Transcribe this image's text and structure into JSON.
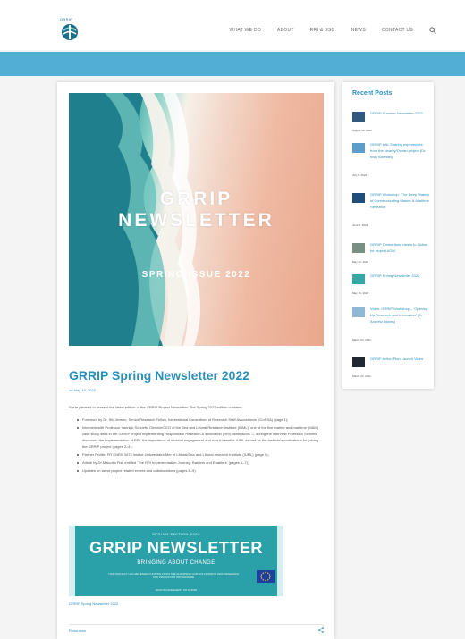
{
  "header": {
    "logo_text": "GRRIP",
    "nav": [
      "WHAT WE DO",
      "ABOUT",
      "RRI & SSG",
      "NEWS",
      "CONTACT US"
    ],
    "search_icon": "search-icon"
  },
  "hero": {
    "title_line1": "GRRIP",
    "title_line2": "NEWSLETTER",
    "subtitle": "SPRING ISSUE 2022"
  },
  "post": {
    "title": "GRRIP Spring Newsletter 2022",
    "date": "on May 19, 2022",
    "intro": "We're pleased to present the latest edition of the GRRIP Project Newsletter. The Spring 2022 edition contains:",
    "items": [
      "Foreword by Dr. Siri Jensen, Senior Research Fellow, International Consortium of Research Staff Associations (ICoRSA) (page 1);",
      "Interview with Professor Yannick Schoefs, Director/CEO of the Sea and Littoral Research Institute (IUML), one of the five marine and maritime (M&M) case study sites in the GRRIP project implementing Responsible Research & Innovation (RRI) dimensions — during the interview Professor Schoefs discusses the implementation of RRI, the importance of societal engagement and how it benefits IUML as well as the Institute's motivations for joining the GRRIP project (pages 2–4);",
      "Partner Profile: FR CNRS 3473 Institut Universitaire Mer et Littoral/Sea and Littoral research Institute (IUML) (page 5);",
      "Article by Dr Malcolm Fisk entitled 'The RRI Implementation Journey: Barriers and Enablers' (pages 6–7);",
      "Updates on latest project related events and collaborations (pages 8–9)."
    ],
    "newsletter_image": {
      "edition": "SPRING EDITION 2022",
      "title": "GRRIP NEWSLETTER",
      "subtitle": "BRINGING ABOUT CHANGE",
      "small_text": "THIS PROJECT HAS RECEIVED FUNDING FROM THE EUROPEAN UNION'S HORIZON 2020 RESEARCH AND INNOVATION PROGRAMME",
      "footer": "GRANT AGREEMENT NO 824595"
    },
    "caption": "GRRIP Spring Newsletter 2022",
    "footer_link": "Resources",
    "share_icon": "share-icon"
  },
  "sidebar": {
    "title": "Recent Posts",
    "posts": [
      {
        "title": "GRRIP Summer Newsletter 2022",
        "date": "August 30, 2022",
        "thumb_color": "#2f5a7d"
      },
      {
        "title": "GRRIP talk: Sharing experiences from the Nearby/Ocean project (Dr. Irish Scientist)",
        "date": "July 5, 2022",
        "thumb_color": "#5c9dc9"
      },
      {
        "title": "GRRIP Workshop: 'The Deep Waters of Communicating Marine & Maritime Research'",
        "date": "June 3, 2022",
        "thumb_color": "#1f4e7a"
      },
      {
        "title": "GRRIP Consortium travels to Lisbon for project AGM",
        "date": "May 30, 2022",
        "thumb_color": "#7a8f84"
      },
      {
        "title": "GRRIP Spring Newsletter 2022",
        "date": "May 19, 2022",
        "thumb_color": "#3aa7a6"
      },
      {
        "title": "Video: GRRIP Workshop – 'Opening Up Research and Innovation' (Dr. Andrew Adams)",
        "date": "March 24, 2022",
        "thumb_color": "#8fb9d6"
      },
      {
        "title": "GRRIP Action Plan Launch Video",
        "date": "March 23, 2022",
        "thumb_color": "#222831"
      }
    ]
  },
  "colors": {
    "accent": "#2b8fb8",
    "banner": "#53aed6",
    "newsletter_teal": "#2aa0a8"
  }
}
